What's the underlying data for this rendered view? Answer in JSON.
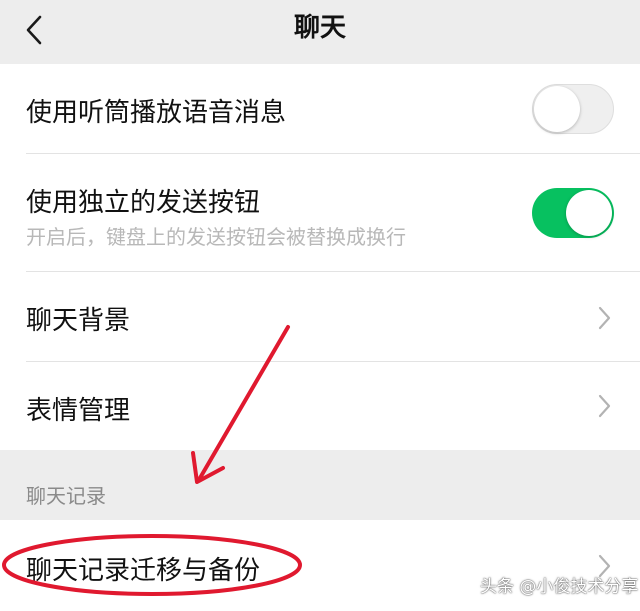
{
  "header": {
    "title": "聊天",
    "back_icon": "chevron-left-icon"
  },
  "settings": {
    "earpiece_voice": {
      "label": "使用听筒播放语音消息",
      "enabled": false
    },
    "standalone_send": {
      "label": "使用独立的发送按钮",
      "description": "开启后，键盘上的发送按钮会被替换成换行",
      "enabled": true
    },
    "chat_background": {
      "label": "聊天背景",
      "icon": "chevron-right-icon"
    },
    "sticker_management": {
      "label": "表情管理",
      "icon": "chevron-right-icon"
    }
  },
  "chat_history": {
    "section_title": "聊天记录",
    "migrate_backup": {
      "label": "聊天记录迁移与备份",
      "icon": "chevron-right-icon"
    }
  },
  "watermark": "头条 @小俊技术分享",
  "colors": {
    "toggle_on": "#07c160",
    "toggle_off": "#efefef",
    "annotation_red": "#e0192f",
    "background": "#ededed"
  }
}
